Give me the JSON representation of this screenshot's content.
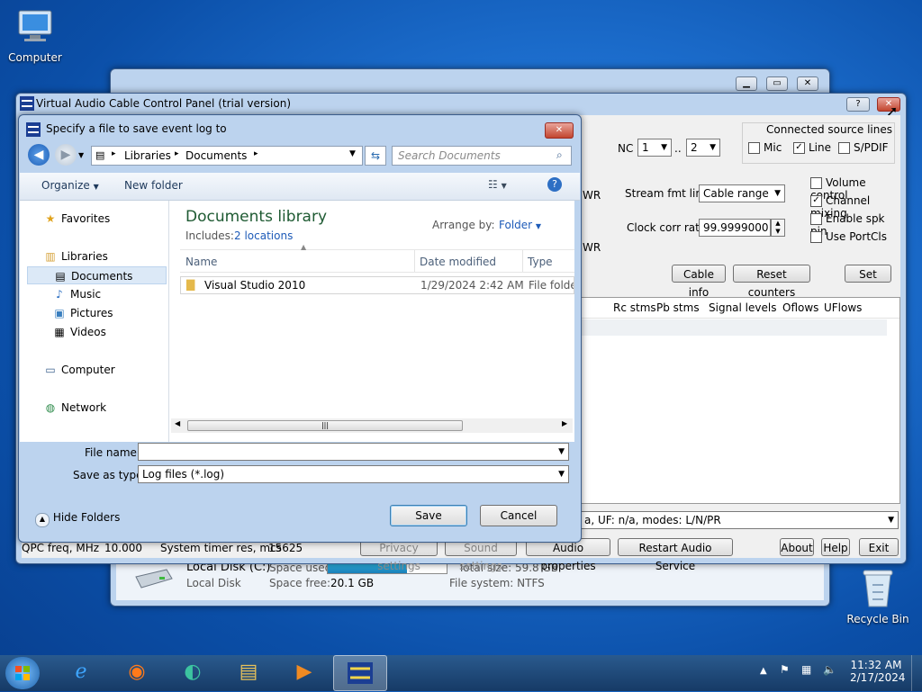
{
  "desktop": {
    "icons": [
      {
        "label": "Computer"
      },
      {
        "label": "Recycle Bin"
      }
    ]
  },
  "vac_window": {
    "title": "Virtual Audio Cable Control Panel (trial version)",
    "nc_label": "NC",
    "nc_from": "1",
    "nc_to": "2",
    "range_sep": "..",
    "wr_label": "WR",
    "connected_source_title": "Connected source lines",
    "sources": [
      {
        "label": "Mic",
        "checked": false
      },
      {
        "label": "Line",
        "checked": true
      },
      {
        "label": "S/PDIF",
        "checked": false
      }
    ],
    "stream_fmt_label": "Stream fmt limit",
    "stream_fmt_value": "Cable range",
    "clock_corr_label": "Clock corr ratio",
    "clock_corr_value": "99.9999000",
    "options": [
      {
        "label": "Volume control",
        "checked": false
      },
      {
        "label": "Channel mixing",
        "checked": true
      },
      {
        "label": "Enable spk pin",
        "checked": false
      },
      {
        "label": "Use PortCls",
        "checked": false
      }
    ],
    "buttons": {
      "cable_info": "Cable info",
      "reset_counters": "Reset counters",
      "set": "Set"
    },
    "columns": [
      "Rc stms",
      "Pb stms",
      "Signal levels",
      "Oflows",
      "UFlows"
    ],
    "status_combo": "a, UF: n/a, modes: L/N/PR",
    "qpc_label": "QPC freq, MHz",
    "qpc_value": "10.000",
    "timer_label": "System timer res, mcs",
    "timer_value": "15625",
    "bottom_buttons": {
      "privacy": "Privacy settings",
      "sound": "Sound settings",
      "audio_props": "Audio properties",
      "restart": "Restart Audio Service",
      "about": "About",
      "help": "Help",
      "exit": "Exit"
    }
  },
  "explorer_back": {
    "disk_name": "Local Disk (C:)",
    "disk_sub": "Local Disk",
    "space_used_label": "Space used:",
    "space_used_fraction": 0.67,
    "total_size": "Total size: 59.8 GB",
    "space_free_label": "Space free:",
    "space_free_value": "20.1 GB",
    "file_system": "File system: NTFS"
  },
  "dialog": {
    "title": "Specify a file to save event log to",
    "breadcrumb": [
      "Libraries",
      "Documents"
    ],
    "search_placeholder": "Search Documents",
    "toolbar": {
      "organize": "Organize",
      "new_folder": "New folder"
    },
    "nav": {
      "favorites": "Favorites",
      "libraries": "Libraries",
      "library_items": [
        "Documents",
        "Music",
        "Pictures",
        "Videos"
      ],
      "computer": "Computer",
      "network": "Network"
    },
    "library_title": "Documents library",
    "includes_label": "Includes:",
    "includes_link": "2 locations",
    "arrange_label": "Arrange by:",
    "arrange_value": "Folder",
    "columns": [
      "Name",
      "Date modified",
      "Type"
    ],
    "files": [
      {
        "name": "Visual Studio 2010",
        "date": "1/29/2024 2:42 AM",
        "type": "File folder"
      }
    ],
    "file_name_label": "File name:",
    "file_name_value": "",
    "save_type_label": "Save as type:",
    "save_type_value": "Log files (*.log)",
    "hide_folders": "Hide Folders",
    "save": "Save",
    "cancel": "Cancel"
  },
  "taskbar": {
    "time": "11:32 AM",
    "date": "2/17/2024"
  }
}
